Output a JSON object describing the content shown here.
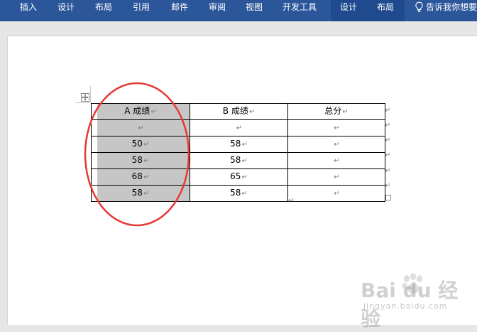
{
  "ribbon": {
    "tabs": [
      {
        "label": "插入"
      },
      {
        "label": "设计"
      },
      {
        "label": "布局"
      },
      {
        "label": "引用"
      },
      {
        "label": "邮件"
      },
      {
        "label": "审阅"
      },
      {
        "label": "视图"
      },
      {
        "label": "开发工具"
      }
    ],
    "table_tabs": [
      {
        "label": "设计"
      },
      {
        "label": "布局"
      }
    ],
    "tell_me": "告诉我你想要"
  },
  "table": {
    "headers": [
      "A 成绩",
      "B 成绩",
      "总分"
    ],
    "rows": [
      [
        "",
        "",
        ""
      ],
      [
        "50",
        "58",
        ""
      ],
      [
        "58",
        "58",
        ""
      ],
      [
        "68",
        "65",
        ""
      ],
      [
        "58",
        "58",
        ""
      ]
    ]
  },
  "marks": {
    "cell_end": "↵"
  },
  "watermark": {
    "brand": "Bai du 经验",
    "url": "jingyan.baidu.com"
  },
  "colors": {
    "ribbon": "#2b579a",
    "selection": "#c6c6c6",
    "annotation": "#e53935"
  }
}
